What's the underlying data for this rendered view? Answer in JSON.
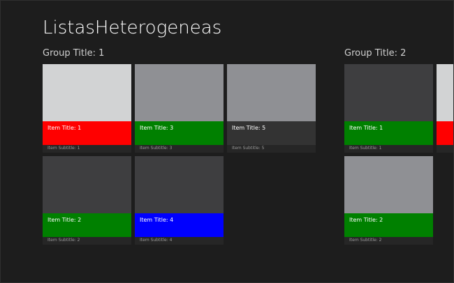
{
  "app": {
    "title": "ListasHeterogeneas"
  },
  "colors": {
    "background": "#1d1d1d",
    "red": "#ff0000",
    "green": "#008000",
    "blue": "#0000ff",
    "dark_bar": "#333333",
    "image_light": "#d2d3d4",
    "image_mid": "#8f9094",
    "image_dark": "#3e3e40"
  },
  "groups": [
    {
      "title": "Group Title: 1",
      "items": [
        {
          "title": "Item Title: 1",
          "subtitle": "Item Subtitle: 1",
          "image": "#d2d3d4",
          "bar": "#ff0000"
        },
        {
          "title": "Item Title: 2",
          "subtitle": "Item Subtitle: 2",
          "image": "#3e3e40",
          "bar": "#008000"
        },
        {
          "title": "Item Title: 3",
          "subtitle": "Item Subtitle: 3",
          "image": "#8f9094",
          "bar": "#008000"
        },
        {
          "title": "Item Title: 4",
          "subtitle": "Item Subtitle: 4",
          "image": "#3e3e40",
          "bar": "#0000ff"
        },
        {
          "title": "Item Title: 5",
          "subtitle": "Item Subtitle: 5",
          "image": "#8f9094",
          "bar": "#333333"
        }
      ]
    },
    {
      "title": "Group Title: 2",
      "items": [
        {
          "title": "Item Title: 1",
          "subtitle": "Item Subtitle: 1",
          "image": "#3e3e40",
          "bar": "#008000"
        },
        {
          "title": "Item Title: 2",
          "subtitle": "Item Subtitle: 2",
          "image": "#8f9094",
          "bar": "#008000"
        },
        {
          "title": "",
          "subtitle": "",
          "image": "#d2d3d4",
          "bar": "#ff0000"
        }
      ]
    }
  ]
}
